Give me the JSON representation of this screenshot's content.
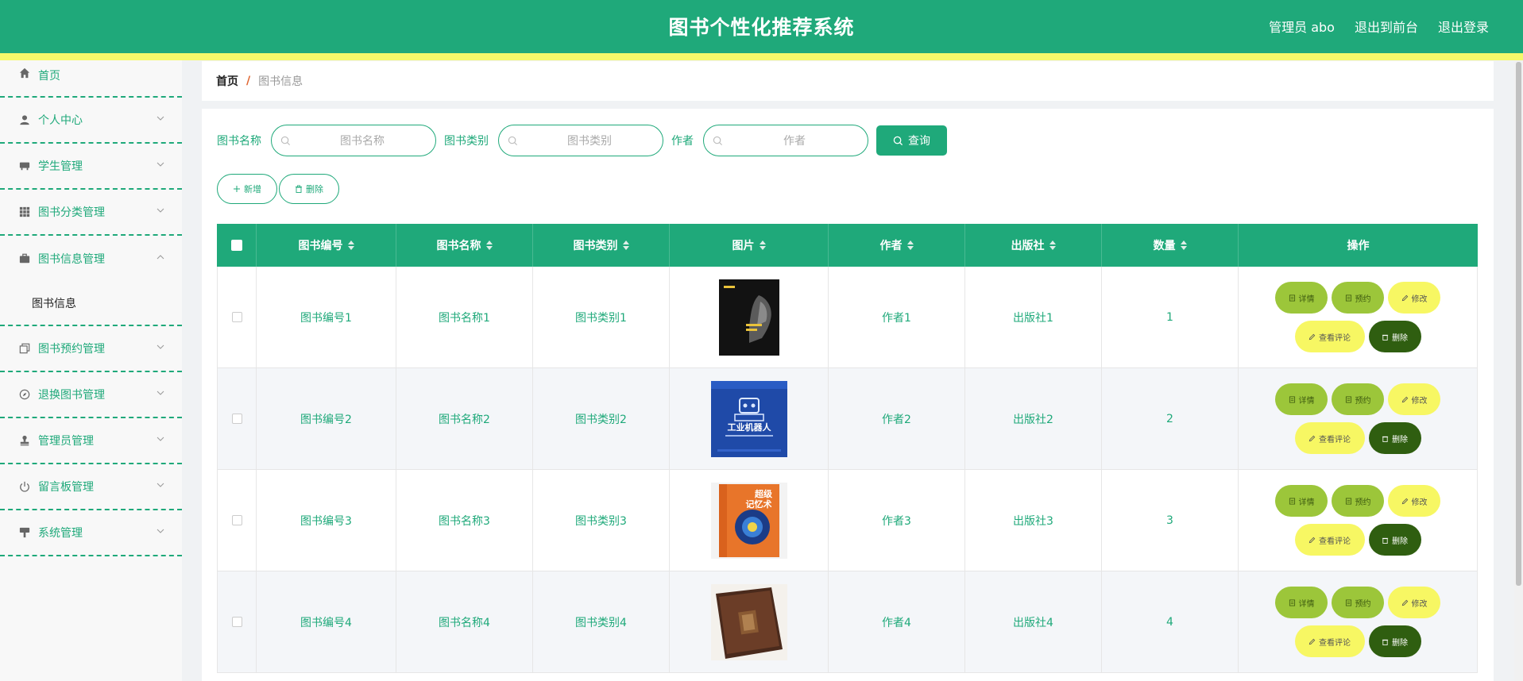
{
  "header": {
    "title": "图书个性化推荐系统",
    "admin": "管理员 abo",
    "to_front": "退出到前台",
    "logout": "退出登录"
  },
  "sidebar": {
    "items": [
      {
        "label": "首页",
        "icon": "home-icon"
      },
      {
        "label": "个人中心",
        "icon": "user-icon"
      },
      {
        "label": "学生管理",
        "icon": "seat-icon"
      },
      {
        "label": "图书分类管理",
        "icon": "grid-icon"
      },
      {
        "label": "图书信息管理",
        "icon": "briefcase-icon"
      },
      {
        "label": "图书预约管理",
        "icon": "copy-icon"
      },
      {
        "label": "退换图书管理",
        "icon": "compass-icon"
      },
      {
        "label": "管理员管理",
        "icon": "stamp-icon"
      },
      {
        "label": "留言板管理",
        "icon": "power-icon"
      },
      {
        "label": "系统管理",
        "icon": "brush-icon"
      }
    ],
    "submenu_label": "图书信息"
  },
  "breadcrumb": {
    "home": "首页",
    "separator": "/",
    "current": "图书信息"
  },
  "search": {
    "name_label": "图书名称",
    "name_placeholder": "图书名称",
    "category_label": "图书类别",
    "category_placeholder": "图书类别",
    "author_label": "作者",
    "author_placeholder": "作者",
    "query_label": "查询"
  },
  "actions": {
    "add_label": "新增",
    "delete_label": "删除"
  },
  "table": {
    "headers": [
      "图书编号",
      "图书名称",
      "图书类别",
      "图片",
      "作者",
      "出版社",
      "数量",
      "操作"
    ],
    "rows": [
      {
        "no": "图书编号1",
        "name": "图书名称1",
        "category": "图书类别1",
        "author": "作者1",
        "publisher": "出版社1",
        "qty": "1",
        "cover": "black-sports-book"
      },
      {
        "no": "图书编号2",
        "name": "图书名称2",
        "category": "图书类别2",
        "author": "作者2",
        "publisher": "出版社2",
        "qty": "2",
        "cover": "blue-robot-book"
      },
      {
        "no": "图书编号3",
        "name": "图书名称3",
        "category": "图书类别3",
        "author": "作者3",
        "publisher": "出版社3",
        "qty": "3",
        "cover": "orange-memory-book"
      },
      {
        "no": "图书编号4",
        "name": "图书名称4",
        "category": "图书类别4",
        "author": "作者4",
        "publisher": "出版社4",
        "qty": "4",
        "cover": "old-leather-book"
      }
    ],
    "ops": {
      "detail": "详情",
      "reserve": "预约",
      "edit": "修改",
      "review": "查看评论",
      "delete": "删除"
    },
    "cover_texts": {
      "book2_title": "工业机器人",
      "book3_title_line1": "超级",
      "book3_title_line2": "记忆术"
    }
  },
  "colors": {
    "primary": "#1fa97a",
    "stripe": "#f4f96a",
    "detail_btn": "#9cc63a",
    "edit_btn": "#f7f763",
    "delete_btn": "#2f5e10"
  }
}
